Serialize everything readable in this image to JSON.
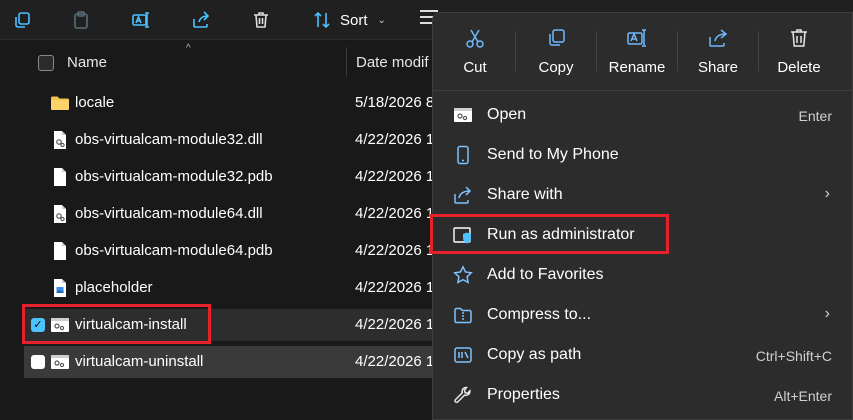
{
  "toolbar": {
    "icons": [
      "copy-icon",
      "paste-icon",
      "rename-icon",
      "share-icon",
      "delete-icon"
    ],
    "sort_label": "Sort",
    "sort_caret": "⌄"
  },
  "columns": {
    "name": "Name",
    "date": "Date modif"
  },
  "files": [
    {
      "name": "locale",
      "date": "5/18/2026 8",
      "type": "folder"
    },
    {
      "name": "obs-virtualcam-module32.dll",
      "date": "4/22/2026 1",
      "type": "dll"
    },
    {
      "name": "obs-virtualcam-module32.pdb",
      "date": "4/22/2026 1",
      "type": "file"
    },
    {
      "name": "obs-virtualcam-module64.dll",
      "date": "4/22/2026 1",
      "type": "dll"
    },
    {
      "name": "obs-virtualcam-module64.pdb",
      "date": "4/22/2026 1",
      "type": "file"
    },
    {
      "name": "placeholder",
      "date": "4/22/2026 1",
      "type": "image"
    },
    {
      "name": "virtualcam-install",
      "date": "4/22/2026 1",
      "type": "script",
      "checked": true
    },
    {
      "name": "virtualcam-uninstall",
      "date": "4/22/2026 1",
      "type": "script"
    }
  ],
  "context_menu": {
    "quick_actions": [
      {
        "label": "Cut",
        "icon": "scissors-icon"
      },
      {
        "label": "Copy",
        "icon": "copy-icon"
      },
      {
        "label": "Rename",
        "icon": "rename-icon"
      },
      {
        "label": "Share",
        "icon": "share-icon"
      },
      {
        "label": "Delete",
        "icon": "trash-icon"
      }
    ],
    "items": [
      {
        "label": "Open",
        "shortcut": "Enter",
        "icon": "open-app-icon"
      },
      {
        "label": "Send to My Phone",
        "shortcut": "",
        "icon": "phone-icon"
      },
      {
        "label": "Share with",
        "shortcut": "",
        "icon": "share-with-icon",
        "submenu": true
      },
      {
        "label": "Run as administrator",
        "shortcut": "",
        "icon": "shield-icon"
      },
      {
        "label": "Add to Favorites",
        "shortcut": "",
        "icon": "star-icon"
      },
      {
        "label": "Compress to...",
        "shortcut": "",
        "icon": "zip-icon",
        "submenu": true
      },
      {
        "label": "Copy as path",
        "shortcut": "Ctrl+Shift+C",
        "icon": "path-icon"
      },
      {
        "label": "Properties",
        "shortcut": "Alt+Enter",
        "icon": "wrench-icon"
      }
    ],
    "submenu_arrow": "›"
  },
  "colors": {
    "accent": "#4cc2ff",
    "highlight_box": "#e8202b",
    "menu_bg": "#2c2c2c",
    "window_bg": "#191919"
  }
}
